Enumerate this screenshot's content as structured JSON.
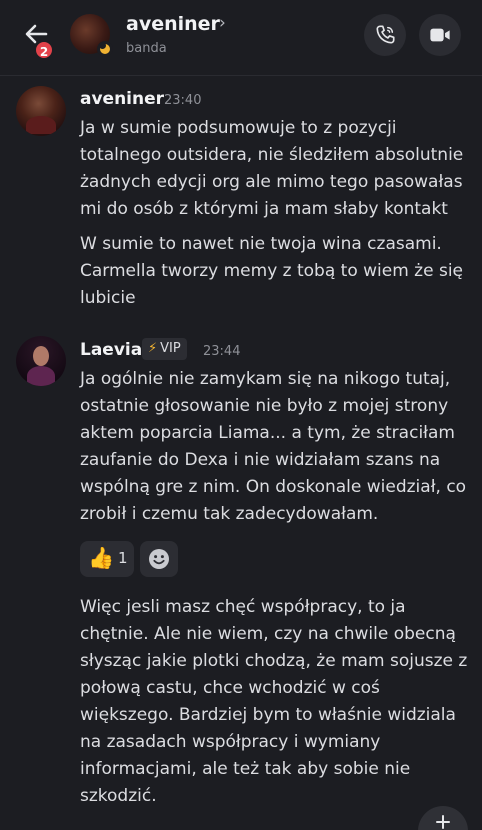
{
  "header": {
    "notification_count": "2",
    "name": "aveniner",
    "chevron": "›",
    "subtitle": "banda",
    "icons": [
      "back-arrow-icon",
      "phone-icon",
      "video-camera-icon"
    ]
  },
  "messages": [
    {
      "author": "aveniner",
      "time": "23:40",
      "paragraphs": [
        "Ja w sumie podsumowuje to z pozycji totalnego outsidera, nie śledziłem absolutnie żadnych edycji org ale mimo tego pasowałas mi do osób z którymi ja mam słaby kontakt",
        "W sumie to nawet nie twoja wina czasami. Carmella tworzy memy z tobą to wiem że się lubicie"
      ]
    },
    {
      "author": "Laevia",
      "tag": "VIP",
      "tag_icon": "⚡",
      "time": "23:44",
      "paragraphs": [
        "Ja ogólnie nie zamykam się na nikogo tutaj, ostatnie głosowanie nie było z mojej strony aktem poparcia Liama... a tym, że straciłam zaufanie do Dexa i nie widziałam szans na wspólną gre z nim. On doskonale wiedział, co zrobił i czemu tak zadecydowałam.",
        "Więc jesli masz chęć współpracy, to ja chętnie. Ale nie wiem, czy na chwile obecną słysząc jakie plotki chodzą, że mam sojusze z połową castu, chce wchodzić w coś większego. Bardziej bym to właśnie widziala na zasadach współpracy i wymiany informacjami, ale też tak aby sobie nie szkodzić."
      ],
      "reaction": {
        "emoji": "👍",
        "count": "1"
      }
    }
  ],
  "colors": {
    "background": "#1c1d22",
    "badge": "#e2424a",
    "vip_bolt": "#f0b232",
    "idle_status": "#f0b232"
  }
}
